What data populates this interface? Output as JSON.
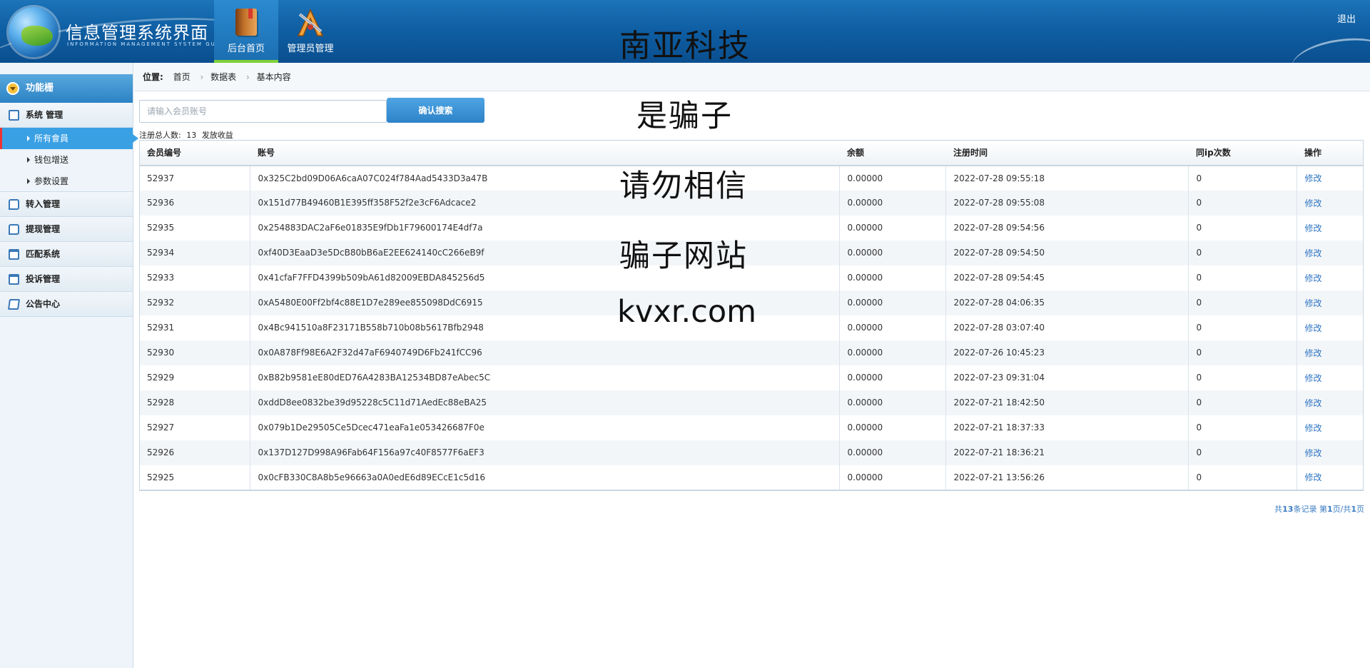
{
  "header": {
    "logo_title": "信息管理系统界面",
    "logo_subtitle": "INFORMATION MANAGEMENT SYSTEM GUI",
    "nav_tabs": [
      {
        "label": "后台首页",
        "icon": "book-icon",
        "active": true
      },
      {
        "label": "管理员管理",
        "icon": "tools-icon",
        "active": false
      }
    ],
    "brand_text": "南亚科技",
    "logout_label": "退出"
  },
  "sidebar": {
    "title": "功能栅",
    "groups": [
      {
        "label": "系统 管理",
        "icon": "list-icon",
        "children": [
          {
            "label": "所有會員",
            "active": true
          },
          {
            "label": "钱包增送",
            "active": false
          },
          {
            "label": "参数设置",
            "active": false
          }
        ]
      },
      {
        "label": "转入管理",
        "icon": "chat-icon"
      },
      {
        "label": "提现管理",
        "icon": "chat-icon"
      },
      {
        "label": "匹配系统",
        "icon": "calendar-icon"
      },
      {
        "label": "投诉管理",
        "icon": "calendar-icon"
      },
      {
        "label": "公告中心",
        "icon": "edit-icon"
      }
    ]
  },
  "breadcrumb": {
    "label": "位置:",
    "items": [
      "首页",
      "数据表",
      "基本内容"
    ]
  },
  "search": {
    "placeholder": "请输入会员账号",
    "value": "",
    "button_label": "确认搜索"
  },
  "summary": {
    "prefix": "注册总人数:",
    "count": "13",
    "suffix": "发放收益"
  },
  "overlay": {
    "line1": "是骗子",
    "line2": "请勿相信",
    "line3": "骗子网站",
    "line4": "kvxr.com"
  },
  "table": {
    "columns": [
      "会员编号",
      "账号",
      "余额",
      "注册时间",
      "同ip次数",
      "操作"
    ],
    "rows": [
      [
        "52937",
        "0x325C2bd09D06A6caA07C024f784Aad5433D3a47B",
        "0.00000",
        "2022-07-28 09:55:18",
        "0",
        "修改"
      ],
      [
        "52936",
        "0x151d77B49460B1E395ff358F52f2e3cF6Adcace2",
        "0.00000",
        "2022-07-28 09:55:08",
        "0",
        "修改"
      ],
      [
        "52935",
        "0x254883DAC2aF6e01835E9fDb1F79600174E4df7a",
        "0.00000",
        "2022-07-28 09:54:56",
        "0",
        "修改"
      ],
      [
        "52934",
        "0xf40D3EaaD3e5DcB80bB6aE2EE624140cC266eB9f",
        "0.00000",
        "2022-07-28 09:54:50",
        "0",
        "修改"
      ],
      [
        "52933",
        "0x41cfaF7FFD4399b509bA61d82009EBDA845256d5",
        "0.00000",
        "2022-07-28 09:54:45",
        "0",
        "修改"
      ],
      [
        "52932",
        "0xA5480E00Ff2bf4c88E1D7e289ee855098DdC6915",
        "0.00000",
        "2022-07-28 04:06:35",
        "0",
        "修改"
      ],
      [
        "52931",
        "0x4Bc941510a8F23171B558b710b08b5617Bfb2948",
        "0.00000",
        "2022-07-28 03:07:40",
        "0",
        "修改"
      ],
      [
        "52930",
        "0x0A878Ff98E6A2F32d47aF6940749D6Fb241fCC96",
        "0.00000",
        "2022-07-26 10:45:23",
        "0",
        "修改"
      ],
      [
        "52929",
        "0xB82b9581eE80dED76A4283BA12534BD87eAbec5C",
        "0.00000",
        "2022-07-23 09:31:04",
        "0",
        "修改"
      ],
      [
        "52928",
        "0xddD8ee0832be39d95228c5C11d71AedEc88eBA25",
        "0.00000",
        "2022-07-21 18:42:50",
        "0",
        "修改"
      ],
      [
        "52927",
        "0x079b1De29505Ce5Dcec471eaFa1e053426687F0e",
        "0.00000",
        "2022-07-21 18:37:33",
        "0",
        "修改"
      ],
      [
        "52926",
        "0x137D127D998A96Fab64F156a97c40F8577F6aEF3",
        "0.00000",
        "2022-07-21 18:36:21",
        "0",
        "修改"
      ],
      [
        "52925",
        "0x0cFB330C8A8b5e96663a0A0edE6d89ECcE1c5d16",
        "0.00000",
        "2022-07-21 13:56:26",
        "0",
        "修改"
      ]
    ]
  },
  "pagination": {
    "text_total_prefix": "共",
    "total": "13",
    "text_total_suffix": "条记录 第",
    "current": "1",
    "text_mid": "页/共",
    "pages": "1",
    "text_end": "页"
  }
}
